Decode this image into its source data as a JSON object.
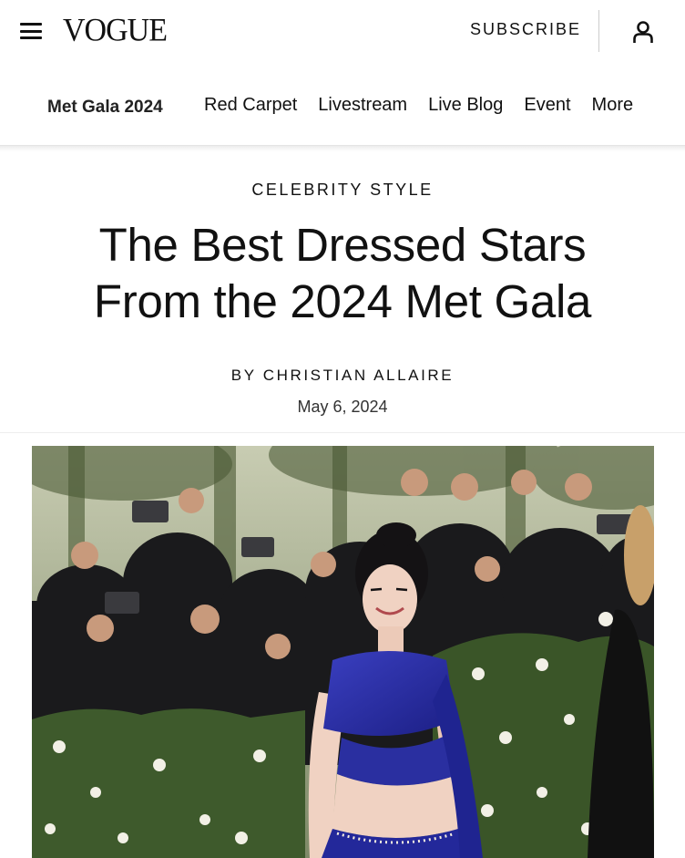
{
  "header": {
    "menu_icon": "hamburger-menu-icon",
    "logo": "VOGUE",
    "subscribe_label": "SUBSCRIBE",
    "account_icon": "user-account-icon"
  },
  "subnav": {
    "brand": "Met Gala 2024",
    "links": [
      "Red Carpet",
      "Livestream",
      "Live Blog",
      "Event",
      "More"
    ]
  },
  "article": {
    "category": "CELEBRITY STYLE",
    "title_line1": "The Best Dressed Stars",
    "title_line2": "From the 2024 Met Gala",
    "byline_prefix": "BY",
    "author": "CHRISTIAN ALLAIRE",
    "date": "May 6, 2024"
  },
  "hero_image": {
    "subject": "Woman in royal-blue draped gown at Met Gala red carpet, photographers behind",
    "dress_color": "#2a2fa0",
    "foliage_color": "#3e5a2c"
  }
}
